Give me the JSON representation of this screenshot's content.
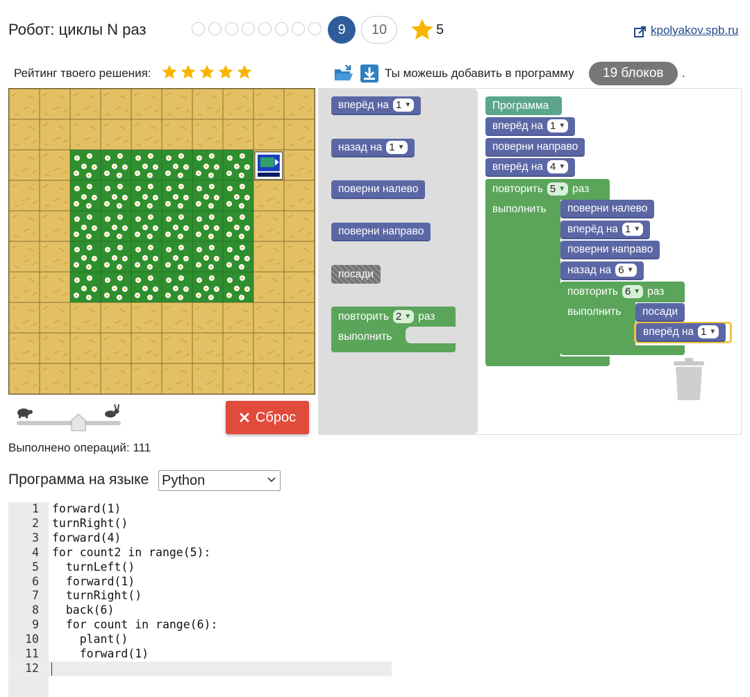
{
  "header": {
    "title": "Робот: циклы N раз",
    "level_dots_count": 8,
    "current_level": "9",
    "next_level": "10",
    "score": "5",
    "site_link": "kpolyakov.spb.ru"
  },
  "rating": {
    "label": "Рейтинг твоего решения:",
    "stars": 5
  },
  "toolbar": {
    "blocks_text": "Ты можешь добавить в программу",
    "blocks_badge": "19 блоков",
    "blocks_trailing": "."
  },
  "controls": {
    "reset_label": "Сброс",
    "operations_text": "Выполнено операций: 111",
    "speed_level": 0.55
  },
  "language": {
    "label": "Программа на языке",
    "selected": "Python"
  },
  "code": {
    "lines": [
      "forward(1)",
      "turnRight()",
      "forward(4)",
      "for count2 in range(5):",
      "  turnLeft()",
      "  forward(1)",
      "  turnRight()",
      "  back(6)",
      "  for count in range(6):",
      "    plant()",
      "    forward(1)",
      ""
    ],
    "active_line": 12
  },
  "field": {
    "cols": 10,
    "rows": 10,
    "flower_cells": {
      "col_from": 2,
      "col_to": 7,
      "row_from": 2,
      "row_to": 6
    },
    "robot_cell": {
      "col": 8,
      "row": 2
    }
  },
  "toolbox": {
    "forward_label": "вперёд на",
    "forward_value": "1",
    "back_label": "назад на",
    "back_value": "1",
    "turn_left": "поверни налево",
    "turn_right": "поверни направо",
    "plant": "посади",
    "repeat_label": "повторить",
    "repeat_value": "2",
    "repeat_suffix": "раз",
    "do_label": "выполнить"
  },
  "program": {
    "header": "Программа",
    "b1_label": "вперёд на",
    "b1_value": "1",
    "b2_label": "поверни направо",
    "b3_label": "вперёд на",
    "b3_value": "4",
    "loop1_label": "повторить",
    "loop1_value": "5",
    "loop1_suffix": "раз",
    "loop1_do": "выполнить",
    "b4_label": "поверни налево",
    "b5_label": "вперёд на",
    "b5_value": "1",
    "b6_label": "поверни направо",
    "b7_label": "назад на",
    "b7_value": "6",
    "loop2_label": "повторить",
    "loop2_value": "6",
    "loop2_suffix": "раз",
    "loop2_do": "выполнить",
    "b8_label": "посади",
    "b9_label": "вперёд на",
    "b9_value": "1"
  },
  "colors": {
    "move_block": "#5b67a5",
    "control_block": "#5ba55b",
    "program_block": "#5ba58c",
    "reset_button": "#e14b3b",
    "level_current": "#2f5d9b",
    "star": "#f7b500",
    "sand": "#e3c063",
    "grass": "#2f8f2f"
  }
}
